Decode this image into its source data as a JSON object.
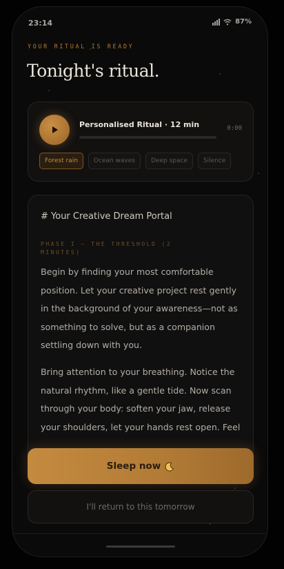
{
  "status_bar": {
    "time": "23:14",
    "battery": "87%"
  },
  "header": {
    "kicker": "YOUR RITUAL IS READY",
    "title": "Tonight's ritual."
  },
  "player": {
    "track_title": "Personalised Ritual · 12 min",
    "elapsed": "0:00",
    "progress": 0,
    "accent_color": "#c98f45",
    "soundscapes": [
      {
        "label": "Forest rain",
        "selected": true
      },
      {
        "label": "Ocean waves",
        "selected": false
      },
      {
        "label": "Deep space",
        "selected": false
      },
      {
        "label": "Silence",
        "selected": false
      }
    ]
  },
  "script": {
    "heading": "# Your Creative Dream Portal",
    "phase_label": "PHASE I — THE THRESHOLD (2 MINUTES)",
    "paragraph_1": "Begin by finding your most comfortable position. Let your creative project rest gently in the background of your awareness—not as something to solve, but as a companion settling down with you.",
    "paragraph_2": "Bring attention to your breathing. Notice the natural rhythm, like a gentle tide. Now scan through your body: soften your jaw, release your shoulders, let your hands rest open. Feel"
  },
  "actions": {
    "sleep_label": "Sleep now",
    "sleep_icon": "crescent-moon-icon",
    "return_label": "I'll return to this tomorrow"
  }
}
